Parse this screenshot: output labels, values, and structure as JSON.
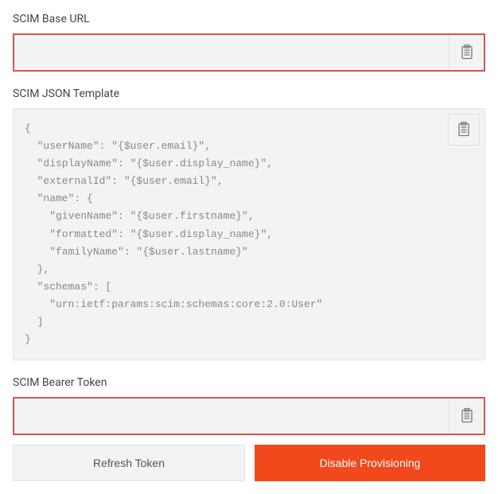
{
  "labels": {
    "scim_base_url": "SCIM Base URL",
    "scim_json_template": "SCIM JSON Template",
    "scim_bearer_token": "SCIM Bearer Token"
  },
  "values": {
    "scim_base_url": "",
    "scim_bearer_token": "",
    "json_template": "{\n  \"userName\": \"{$user.email}\",\n  \"displayName\": \"{$user.display_name}\",\n  \"externalId\": \"{$user.email}\",\n  \"name\": {\n    \"givenName\": \"{$user.firstname}\",\n    \"formatted\": \"{$user.display_name}\",\n    \"familyName\": \"{$user.lastname}\"\n  },\n  \"schemas\": [\n    \"urn:ietf:params:scim:schemas:core:2.0:User\"\n  ]\n}"
  },
  "buttons": {
    "refresh_token": "Refresh Token",
    "disable_provisioning": "Disable Provisioning"
  }
}
